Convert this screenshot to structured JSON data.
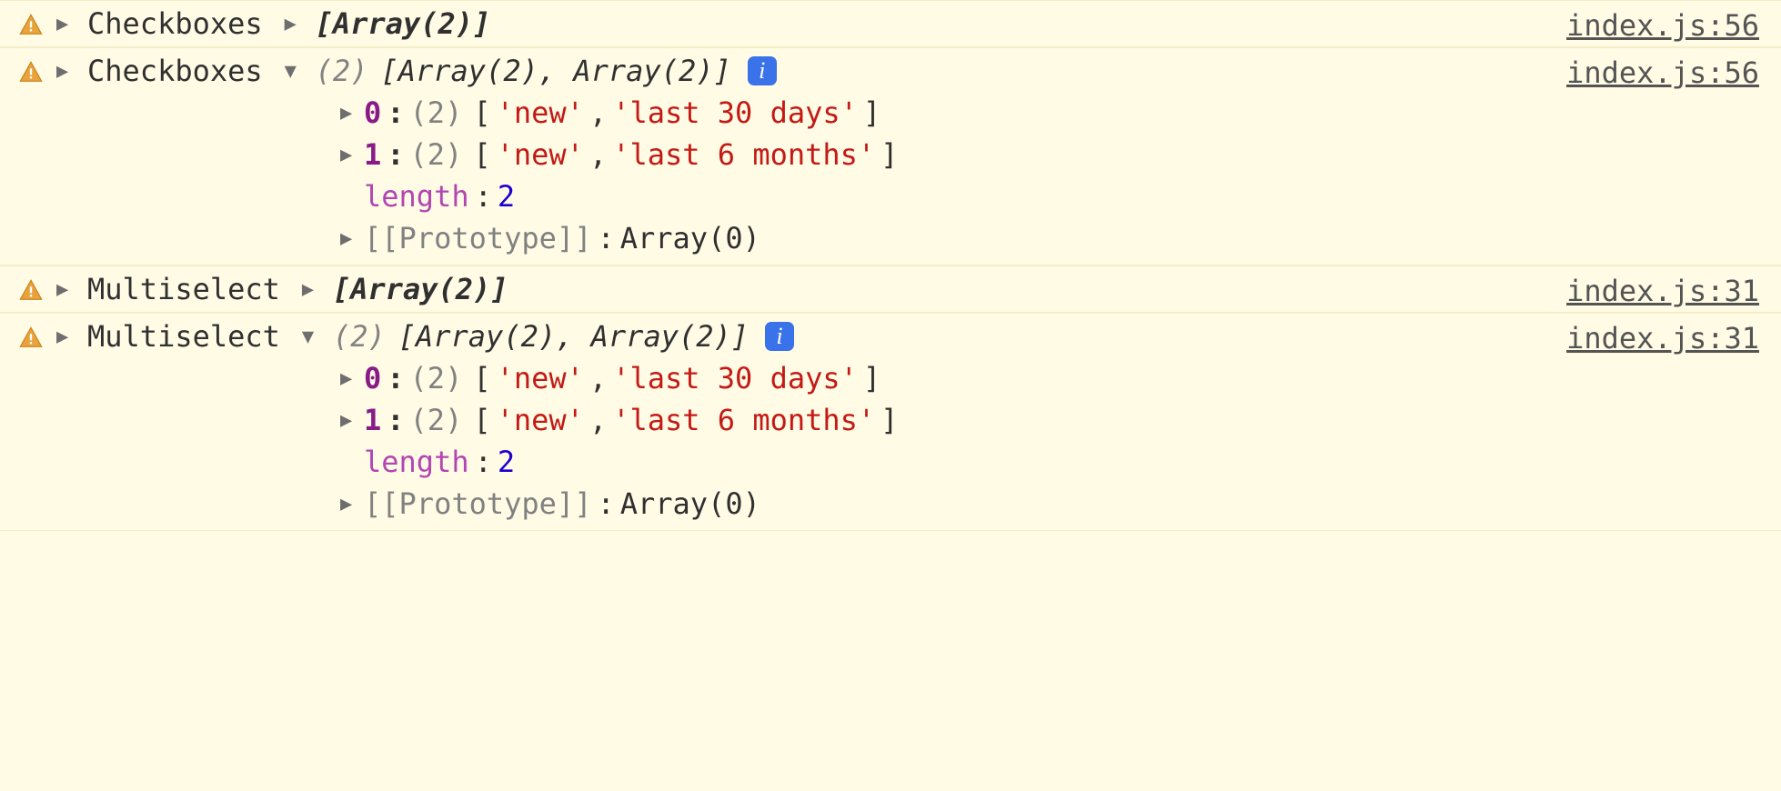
{
  "entries": [
    {
      "label": "Checkboxes",
      "expanded": false,
      "summary_collapsed": "[Array(2)]",
      "source": "index.js:56"
    },
    {
      "label": "Checkboxes",
      "expanded": true,
      "summary_expanded_prefix": "(2)",
      "summary_expanded_body": "[Array(2), Array(2)]",
      "info_badge": "i",
      "source": "index.js:56",
      "items": [
        {
          "index": "0",
          "count": "(2)",
          "open": "[",
          "v0": "'new'",
          "sep": ", ",
          "v1": "'last 30 days'",
          "close": "]"
        },
        {
          "index": "1",
          "count": "(2)",
          "open": "[",
          "v0": "'new'",
          "sep": ", ",
          "v1": "'last 6 months'",
          "close": "]"
        }
      ],
      "length_label": "length",
      "length_value": "2",
      "proto_label": "[[Prototype]]",
      "proto_value": "Array(0)"
    },
    {
      "label": "Multiselect",
      "expanded": false,
      "summary_collapsed": "[Array(2)]",
      "source": "index.js:31"
    },
    {
      "label": "Multiselect",
      "expanded": true,
      "summary_expanded_prefix": "(2)",
      "summary_expanded_body": "[Array(2), Array(2)]",
      "info_badge": "i",
      "source": "index.js:31",
      "items": [
        {
          "index": "0",
          "count": "(2)",
          "open": "[",
          "v0": "'new'",
          "sep": ", ",
          "v1": "'last 30 days'",
          "close": "]"
        },
        {
          "index": "1",
          "count": "(2)",
          "open": "[",
          "v0": "'new'",
          "sep": ", ",
          "v1": "'last 6 months'",
          "close": "]"
        }
      ],
      "length_label": "length",
      "length_value": "2",
      "proto_label": "[[Prototype]]",
      "proto_value": "Array(0)"
    }
  ]
}
